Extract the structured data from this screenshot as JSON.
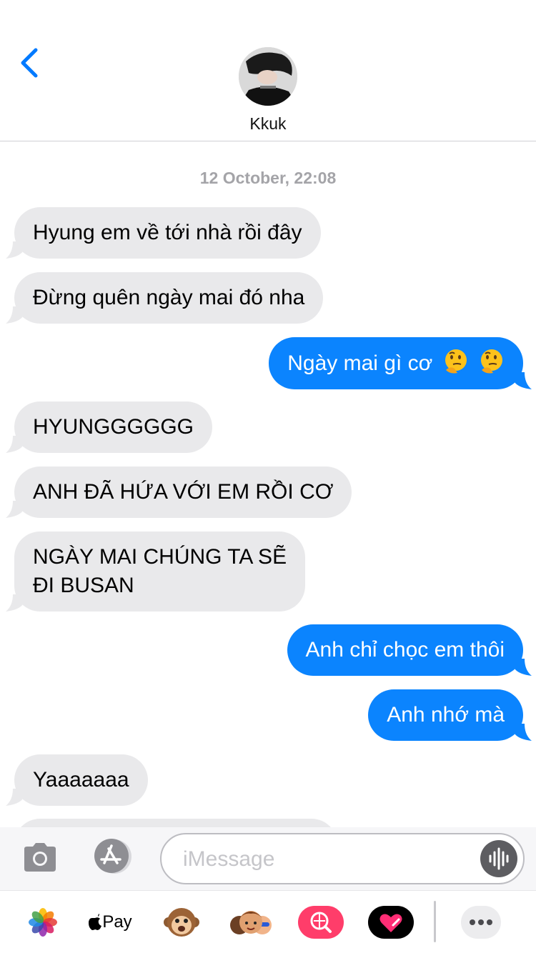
{
  "header": {
    "contact_name": "Kkuk",
    "back_icon": "chevron-left-icon"
  },
  "thread": {
    "timestamp": "12 October, 22:08",
    "messages": [
      {
        "direction": "incoming",
        "text": "Hyung em về tới nhà rồi đây"
      },
      {
        "direction": "incoming",
        "text": "Đừng quên ngày mai đó nha"
      },
      {
        "direction": "outgoing",
        "text": "Ngày mai gì cơ",
        "emoji": [
          "thinking-face",
          "thinking-face"
        ]
      },
      {
        "direction": "incoming",
        "text": "HYUNGGGGGG"
      },
      {
        "direction": "incoming",
        "text": "ANH ĐÃ HỨA VỚI EM RỒI CƠ"
      },
      {
        "direction": "incoming",
        "text_line1": "NGÀY MAI CHÚNG TA SẼ",
        "text_line2": "ĐI BUSAN"
      },
      {
        "direction": "outgoing",
        "text": "Anh chỉ chọc em thôi"
      },
      {
        "direction": "outgoing",
        "text": "Anh nhớ mà"
      },
      {
        "direction": "incoming",
        "text": "Yaaaaaaa"
      }
    ]
  },
  "composer": {
    "placeholder": "iMessage",
    "camera_icon": "camera-icon",
    "app_store_icon": "app-store-icon",
    "audio_icon": "audio-waveform-icon"
  },
  "app_drawer": {
    "apple_pay_label": "Pay",
    "apps": [
      "photos-icon",
      "apple-pay-icon",
      "animoji-monkey-icon",
      "memoji-stickers-icon",
      "web-search-icon",
      "digital-touch-icon",
      "more-apps-icon"
    ]
  },
  "colors": {
    "incoming_bubble": "#e9e9eb",
    "outgoing_bubble": "#0b84fe",
    "accent": "#007aff",
    "status_battery": "#ffcc00"
  }
}
